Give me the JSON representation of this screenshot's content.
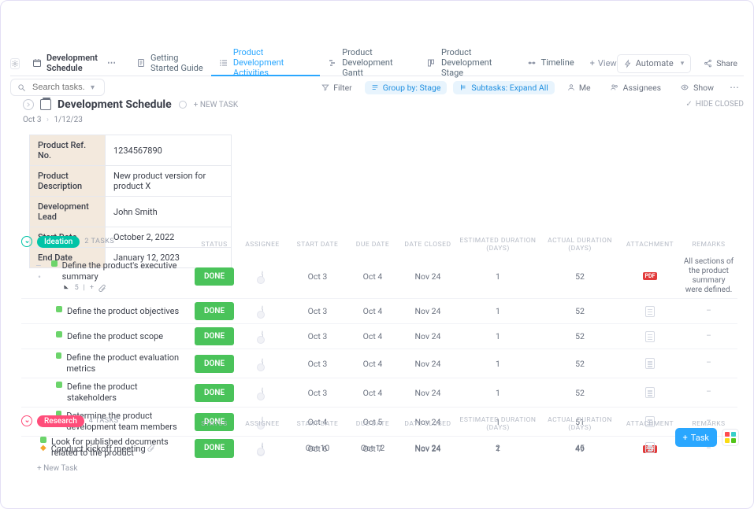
{
  "tabs": {
    "main_title": "Development Schedule",
    "items": [
      {
        "label": "Getting Started Guide",
        "active": false,
        "icon": "doc"
      },
      {
        "label": "Product Development Activities",
        "active": true,
        "icon": "list"
      },
      {
        "label": "Product Development Gantt",
        "active": false,
        "icon": "gantt"
      },
      {
        "label": "Product Development Stage",
        "active": false,
        "icon": "stage"
      },
      {
        "label": "Timeline",
        "active": false,
        "icon": "timeline"
      }
    ],
    "add_view_label": "View",
    "automate_label": "Automate",
    "share_label": "Share"
  },
  "filterbar": {
    "search_placeholder": "Search tasks...",
    "filter": "Filter",
    "groupby": "Group by: Stage",
    "subtasks": "Subtasks: Expand All",
    "me": "Me",
    "assignees": "Assignees",
    "show": "Show"
  },
  "page": {
    "title": "Development Schedule",
    "new_task": "+ NEW TASK",
    "date_start": "Oct 3",
    "date_end": "1/12/23",
    "hide_closed": "HIDE CLOSED"
  },
  "meta": {
    "rows": [
      {
        "label": "Product Ref. No.",
        "value": "1234567890"
      },
      {
        "label": "Product Description",
        "value": "New product version for product X"
      },
      {
        "label": "Development Lead",
        "value": "John Smith"
      },
      {
        "label": "Start Date",
        "value": "October 2, 2022"
      },
      {
        "label": "End Date",
        "value": "January 12, 2023"
      }
    ]
  },
  "columns": [
    "STATUS",
    "ASSIGNEE",
    "START DATE",
    "DUE DATE",
    "DATE CLOSED",
    "ESTIMATED DURATION (DAYS)",
    "ACTUAL DURATION (DAYS)",
    "ATTACHMENT",
    "REMARKS"
  ],
  "groups": [
    {
      "name": "Ideation",
      "color": "teal",
      "count_label": "2 TASKS",
      "tasks": [
        {
          "title": "Define the product's executive summary",
          "status": "DONE",
          "start": "Oct 3",
          "due": "Oct 4",
          "closed": "Nov 24",
          "est": "1",
          "act": "52",
          "attach": "pdf",
          "remarks": "All sections of the product summary were defined.",
          "indent": 0,
          "has_sub": true,
          "sub_count": "5",
          "milestone": false
        },
        {
          "title": "Define the product objectives",
          "status": "DONE",
          "start": "Oct 3",
          "due": "Oct 4",
          "closed": "Nov 24",
          "est": "1",
          "act": "52",
          "attach": "doc",
          "remarks": "–",
          "indent": 1,
          "milestone": false
        },
        {
          "title": "Define the product scope",
          "status": "DONE",
          "start": "Oct 3",
          "due": "Oct 4",
          "closed": "Nov 24",
          "est": "1",
          "act": "52",
          "attach": "doc",
          "remarks": "–",
          "indent": 1,
          "milestone": false
        },
        {
          "title": "Define the product evaluation metrics",
          "status": "DONE",
          "start": "Oct 3",
          "due": "Oct 4",
          "closed": "Nov 24",
          "est": "1",
          "act": "52",
          "attach": "doc",
          "remarks": "–",
          "indent": 1,
          "milestone": false
        },
        {
          "title": "Define the product stakeholders",
          "status": "DONE",
          "start": "Oct 3",
          "due": "Oct 4",
          "closed": "Nov 24",
          "est": "1",
          "act": "52",
          "attach": "doc",
          "remarks": "–",
          "indent": 1,
          "milestone": false
        },
        {
          "title": "Determine the product development team members",
          "status": "DONE",
          "start": "Oct 4",
          "due": "Oct 5",
          "closed": "Nov 24",
          "est": "1",
          "act": "51",
          "attach": "doc",
          "remarks": "–",
          "indent": 1,
          "milestone": false
        },
        {
          "title": "Conduct kickoff meeting",
          "status": "DONE",
          "start": "Oct 6",
          "due": "Oct 7",
          "closed": "Nov 24",
          "est": "1",
          "act": "49",
          "attach": "pdf",
          "remarks": "–",
          "indent": 0,
          "milestone": true
        }
      ],
      "new_task_label": "+ New Task"
    },
    {
      "name": "Research",
      "color": "pink",
      "count_label": "4 TASKS",
      "tasks": [
        {
          "title": "Look for published documents related to the product",
          "status": "DONE",
          "start": "Oct 10",
          "due": "Oct 12",
          "closed": "Nov 24",
          "est": "2",
          "act": "45",
          "attach": "doc",
          "remarks": "–",
          "indent": 0,
          "milestone": false
        }
      ]
    }
  ],
  "fab": {
    "task_label": "Task"
  }
}
